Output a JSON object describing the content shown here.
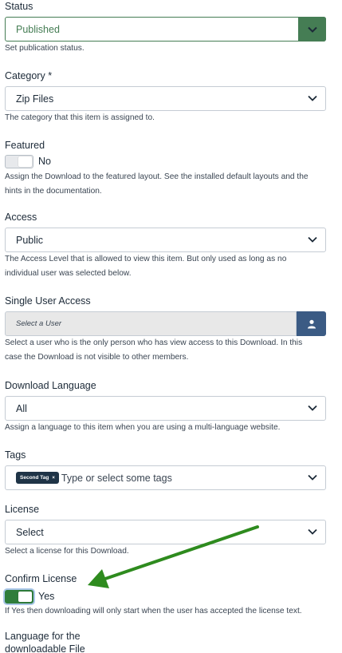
{
  "status": {
    "label": "Status",
    "value": "Published",
    "desc": "Set publication status."
  },
  "category": {
    "label": "Category *",
    "value": "Zip Files",
    "desc": "The category that this item is assigned to."
  },
  "featured": {
    "label": "Featured",
    "toggle_value": "No",
    "desc_line1": "Assign the Download to the featured layout. See the installed default layouts and the",
    "desc_line2": "hints in the documentation."
  },
  "access": {
    "label": "Access",
    "value": "Public",
    "desc_line1": "The Access Level that is allowed to view this item. But only used as long as no",
    "desc_line2": "individual user was selected below."
  },
  "single_user": {
    "label": "Single User Access",
    "placeholder": "Select a User",
    "desc_line1": "Select a user who is the only person who has view access to this Download. In this",
    "desc_line2": "case the Download is not visible to other members."
  },
  "download_language": {
    "label": "Download Language",
    "value": "All",
    "desc": "Assign a language to this item when you are using a multi-language website."
  },
  "tags": {
    "label": "Tags",
    "tag": "Second Tag",
    "tag_remove": "×",
    "placeholder": "Type or select some tags"
  },
  "license": {
    "label": "License",
    "value": "Select",
    "desc": "Select a license for this Download."
  },
  "confirm_license": {
    "label": "Confirm License",
    "toggle_value": "Yes",
    "desc": "If Yes then downloading will only start when the user has accepted the license text."
  },
  "language_file": {
    "label_line1": "Language for the",
    "label_line2": "downloadable File"
  },
  "colors": {
    "status_green": "#457d54",
    "toggle_on": "#2f7d3b",
    "user_button": "#3b5b84",
    "annotation_arrow": "#2e8b1e"
  },
  "icons": {
    "chevron": "chevron-down-icon",
    "user": "user-icon",
    "arrow": "annotation-arrow"
  }
}
